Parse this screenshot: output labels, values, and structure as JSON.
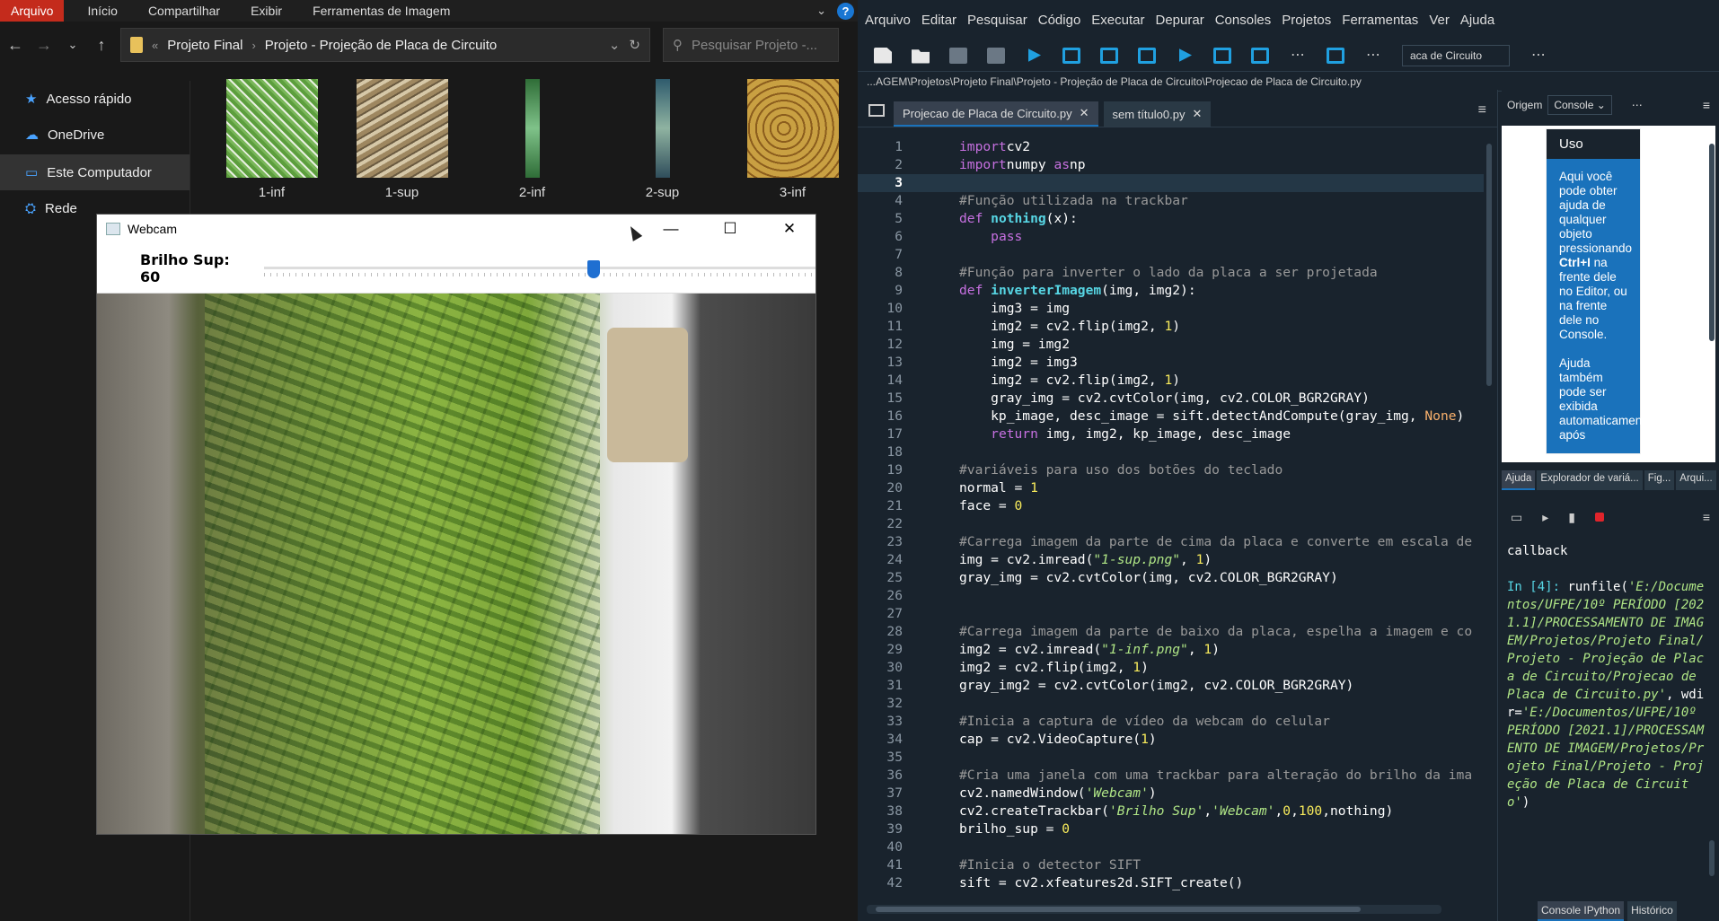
{
  "explorer": {
    "ribbon_tabs": [
      "Arquivo",
      "Início",
      "Compartilhar",
      "Exibir",
      "Ferramentas de Imagem"
    ],
    "address": {
      "part1": "Projeto Final",
      "part2": "Projeto - Projeção de Placa de Circuito"
    },
    "search_placeholder": "Pesquisar Projeto -...",
    "sidebar": [
      "Acesso rápido",
      "OneDrive",
      "Este Computador",
      "Rede"
    ],
    "thumbnails": [
      "1-inf",
      "1-sup",
      "2-inf",
      "2-sup",
      "3-inf"
    ]
  },
  "webcam": {
    "title": "Webcam",
    "trackbar_label": "Brilho Sup: 60",
    "trackbar_value": 60,
    "trackbar_max": 100
  },
  "spyder": {
    "menu": [
      "Arquivo",
      "Editar",
      "Pesquisar",
      "Código",
      "Executar",
      "Depurar",
      "Consoles",
      "Projetos",
      "Ferramentas",
      "Ver",
      "Ajuda"
    ],
    "toolbar_path": "aca de Circuito",
    "file_path": "...AGEM\\Projetos\\Projeto Final\\Projeto - Projeção de Placa de Circuito\\Projecao de Placa de Circuito.py",
    "tabs": [
      "Projecao de Placa de Circuito.py",
      "sem título0.py"
    ],
    "current_line": 3,
    "code_lines": [
      [
        [
          "k",
          "import"
        ],
        [
          "",
          "cv2"
        ]
      ],
      [
        [
          "k",
          "import"
        ],
        [
          "",
          "numpy "
        ],
        [
          "k",
          "as"
        ],
        [
          "",
          "np"
        ]
      ],
      [],
      [
        [
          "c",
          "#Função utilizada na trackbar"
        ]
      ],
      [
        [
          "k",
          "def "
        ],
        [
          "f",
          "nothing"
        ],
        [
          "",
          "(x):"
        ]
      ],
      [
        [
          "",
          "    "
        ],
        [
          "k",
          "pass"
        ]
      ],
      [],
      [
        [
          "c",
          "#Função para inverter o lado da placa a ser projetada"
        ]
      ],
      [
        [
          "k",
          "def "
        ],
        [
          "f",
          "inverterImagem"
        ],
        [
          "",
          "(img, img2):"
        ]
      ],
      [
        [
          "",
          "    img3 = img"
        ]
      ],
      [
        [
          "",
          "    img2 = cv2.flip(img2, "
        ],
        [
          "n",
          "1"
        ],
        [
          "",
          ")"
        ]
      ],
      [
        [
          "",
          "    img = img2"
        ]
      ],
      [
        [
          "",
          "    img2 = img3"
        ]
      ],
      [
        [
          "",
          "    img2 = cv2.flip(img2, "
        ],
        [
          "n",
          "1"
        ],
        [
          "",
          ")"
        ]
      ],
      [
        [
          "",
          "    gray_img = cv2.cvtColor(img, cv2.COLOR_BGR2GRAY)"
        ]
      ],
      [
        [
          "",
          "    kp_image, desc_image = sift.detectAndCompute(gray_img, "
        ],
        [
          "bi",
          "None"
        ],
        [
          "",
          ")"
        ]
      ],
      [
        [
          "",
          "    "
        ],
        [
          "k",
          "return"
        ],
        [
          "",
          " img, img2, kp_image, desc_image"
        ]
      ],
      [],
      [
        [
          "c",
          "#variáveis para uso dos botões do teclado"
        ]
      ],
      [
        [
          "",
          "normal = "
        ],
        [
          "n",
          "1"
        ]
      ],
      [
        [
          "",
          "face = "
        ],
        [
          "n",
          "0"
        ]
      ],
      [],
      [
        [
          "c",
          "#Carrega imagem da parte de cima da placa e converte em escala de"
        ]
      ],
      [
        [
          "",
          "img = cv2.imread("
        ],
        [
          "s",
          "\"1-sup.png\""
        ],
        [
          "",
          ", "
        ],
        [
          "n",
          "1"
        ],
        [
          "",
          ")"
        ]
      ],
      [
        [
          "",
          "gray_img = cv2.cvtColor(img, cv2.COLOR_BGR2GRAY)"
        ]
      ],
      [],
      [],
      [
        [
          "c",
          "#Carrega imagem da parte de baixo da placa, espelha a imagem e co"
        ]
      ],
      [
        [
          "",
          "img2 = cv2.imread("
        ],
        [
          "s",
          "\"1-inf.png\""
        ],
        [
          "",
          ", "
        ],
        [
          "n",
          "1"
        ],
        [
          "",
          ")"
        ]
      ],
      [
        [
          "",
          "img2 = cv2.flip(img2, "
        ],
        [
          "n",
          "1"
        ],
        [
          "",
          ")"
        ]
      ],
      [
        [
          "",
          "gray_img2 = cv2.cvtColor(img2, cv2.COLOR_BGR2GRAY)"
        ]
      ],
      [],
      [
        [
          "c",
          "#Inicia a captura de vídeo da webcam do celular"
        ]
      ],
      [
        [
          "",
          "cap = cv2.VideoCapture("
        ],
        [
          "n",
          "1"
        ],
        [
          "",
          ")"
        ]
      ],
      [],
      [
        [
          "c",
          "#Cria uma janela com uma trackbar para alteração do brilho da ima"
        ]
      ],
      [
        [
          "",
          "cv2.namedWindow("
        ],
        [
          "s",
          "'Webcam'"
        ],
        [
          "",
          ")"
        ]
      ],
      [
        [
          "",
          "cv2.createTrackbar("
        ],
        [
          "s",
          "'Brilho Sup'"
        ],
        [
          "",
          ","
        ],
        [
          "s",
          "'Webcam'"
        ],
        [
          "",
          ","
        ],
        [
          "n",
          "0"
        ],
        [
          "",
          ","
        ],
        [
          "n",
          "100"
        ],
        [
          "",
          ",nothing)"
        ]
      ],
      [
        [
          "",
          "brilho_sup = "
        ],
        [
          "n",
          "0"
        ]
      ],
      [],
      [
        [
          "c",
          "#Inicia o detector SIFT"
        ]
      ],
      [
        [
          "",
          "sift = cv2.xfeatures2d.SIFT_create()"
        ]
      ]
    ],
    "help": {
      "origin_label": "Origem",
      "source_value": "Console",
      "card_title": "Uso",
      "card_text_1": "Aqui você pode obter ajuda de qualquer objeto pressionando ",
      "card_bold_1": "Ctrl+I",
      "card_text_2": " na frente dele no Editor, ou na frente dele no Console.",
      "card_text_3": "Ajuda também pode ser exibida automaticamente após",
      "tabs": [
        "Ajuda",
        "Explorador de variá...",
        "Fig...",
        "Arqui..."
      ]
    },
    "console": {
      "line0": "callback",
      "prompt": "In [4]: ",
      "cmd": "runfile(",
      "arg1": "'E:/Documentos/UFPE/10º PERÍODO [2021.1]/PROCESSAMENTO DE IMAGEM/Projetos/Projeto Final/Projeto - Projeção de Placa de Circuito/Projecao de Placa de Circuito.py'",
      "mid": ", wdir=",
      "arg2": "'E:/Documentos/UFPE/10º PERÍODO [2021.1]/PROCESSAMENTO DE IMAGEM/Projetos/Projeto Final/Projeto - Projeção de Placa de Circuito'",
      "end": ")",
      "tabs": [
        "Console IPython",
        "Histórico"
      ]
    }
  }
}
